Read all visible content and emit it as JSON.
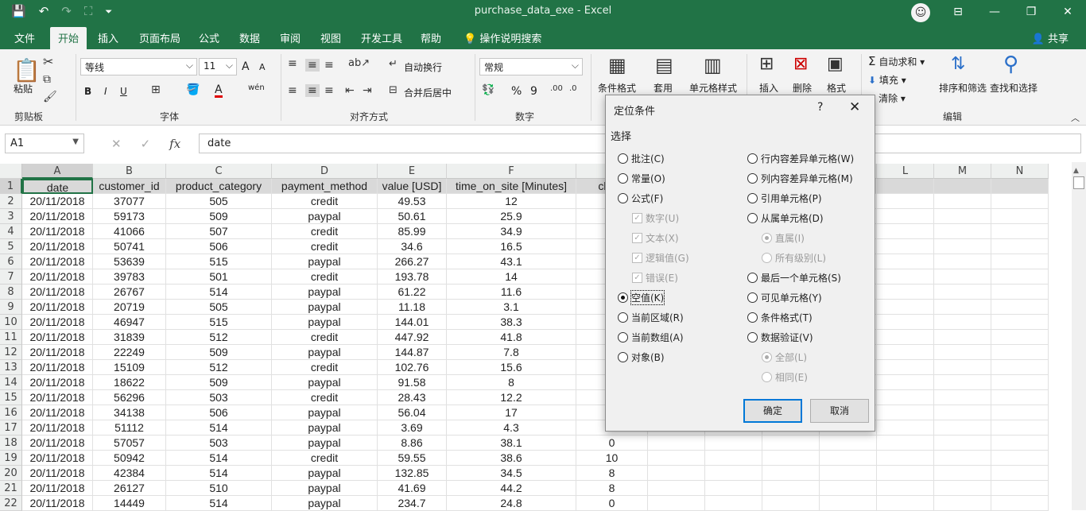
{
  "window": {
    "title": "purchase_data_exe  -  Excel",
    "quick_access": [
      "💾",
      "↶",
      "↷",
      "⛶",
      "⏷"
    ],
    "controls": {
      "ribbon_opts": "⊟",
      "minimize": "—",
      "restore": "❐",
      "close": "✕"
    }
  },
  "menu": {
    "tabs": [
      "文件",
      "开始",
      "插入",
      "页面布局",
      "公式",
      "数据",
      "审阅",
      "视图",
      "开发工具",
      "帮助",
      "操作说明搜索"
    ],
    "active": "开始",
    "share": "共享"
  },
  "ribbon": {
    "clipboard": {
      "paste": "粘贴",
      "label": "剪贴板"
    },
    "font": {
      "name": "等线",
      "size": "11",
      "bold": "B",
      "italic": "I",
      "underline": "U",
      "label": "字体",
      "grow": "A",
      "shrink": "A",
      "phonetic": "wén"
    },
    "alignment": {
      "wrap": "自动换行",
      "merge": "合并后居中",
      "label": "对齐方式"
    },
    "number": {
      "format": "常规",
      "percent": "%",
      "comma": "9",
      "label": "数字"
    },
    "styles": {
      "conditional": "条件格式",
      "table": "套用",
      "cell_styles": "单元格样式"
    },
    "cells": {
      "insert": "插入",
      "delete": "删除",
      "format": "格式"
    },
    "editing": {
      "autosum": "自动求和",
      "fill": "填充",
      "clear": "清除",
      "sort": "排序和筛选",
      "find": "查找和选择",
      "label": "编辑"
    }
  },
  "formula_bar": {
    "name_box": "A1",
    "content": "date",
    "fx": "fx"
  },
  "columns": [
    "A",
    "B",
    "C",
    "D",
    "E",
    "F",
    "G",
    "H",
    "I",
    "J",
    "K",
    "L",
    "M",
    "N"
  ],
  "headers": [
    "date",
    "customer_id",
    "product_category",
    "payment_method",
    "value [USD]",
    "time_on_site [Minutes]",
    "clicks"
  ],
  "rows": [
    [
      "20/11/2018",
      "37077",
      "505",
      "credit",
      "49.53",
      "12",
      ""
    ],
    [
      "20/11/2018",
      "59173",
      "509",
      "paypal",
      "50.61",
      "25.9",
      ""
    ],
    [
      "20/11/2018",
      "41066",
      "507",
      "credit",
      "85.99",
      "34.9",
      ""
    ],
    [
      "20/11/2018",
      "50741",
      "506",
      "credit",
      "34.6",
      "16.5",
      ""
    ],
    [
      "20/11/2018",
      "53639",
      "515",
      "paypal",
      "266.27",
      "43.1",
      ""
    ],
    [
      "20/11/2018",
      "39783",
      "501",
      "credit",
      "193.78",
      "14",
      ""
    ],
    [
      "20/11/2018",
      "26767",
      "514",
      "paypal",
      "61.22",
      "11.6",
      ""
    ],
    [
      "20/11/2018",
      "20719",
      "505",
      "paypal",
      "11.18",
      "3.1",
      ""
    ],
    [
      "20/11/2018",
      "46947",
      "515",
      "paypal",
      "144.01",
      "38.3",
      ""
    ],
    [
      "20/11/2018",
      "31839",
      "512",
      "credit",
      "447.92",
      "41.8",
      ""
    ],
    [
      "20/11/2018",
      "22249",
      "509",
      "paypal",
      "144.87",
      "7.8",
      ""
    ],
    [
      "20/11/2018",
      "15109",
      "512",
      "credit",
      "102.76",
      "15.6",
      ""
    ],
    [
      "20/11/2018",
      "18622",
      "509",
      "paypal",
      "91.58",
      "8",
      ""
    ],
    [
      "20/11/2018",
      "56296",
      "503",
      "credit",
      "28.43",
      "12.2",
      ""
    ],
    [
      "20/11/2018",
      "34138",
      "506",
      "paypal",
      "56.04",
      "17",
      ""
    ],
    [
      "20/11/2018",
      "51112",
      "514",
      "paypal",
      "3.69",
      "4.3",
      ""
    ],
    [
      "20/11/2018",
      "57057",
      "503",
      "paypal",
      "8.86",
      "38.1",
      "0"
    ],
    [
      "20/11/2018",
      "50942",
      "514",
      "credit",
      "59.55",
      "38.6",
      "10"
    ],
    [
      "20/11/2018",
      "42384",
      "514",
      "paypal",
      "132.85",
      "34.5",
      "8"
    ],
    [
      "20/11/2018",
      "26127",
      "510",
      "paypal",
      "41.69",
      "44.2",
      "8"
    ],
    [
      "20/11/2018",
      "14449",
      "514",
      "paypal",
      "234.7",
      "24.8",
      "0"
    ]
  ],
  "dialog": {
    "title": "定位条件",
    "help": "?",
    "close": "✕",
    "section": "选择",
    "left_options": [
      "批注(C)",
      "常量(O)",
      "公式(F)",
      "数字(U)",
      "文本(X)",
      "逻辑值(G)",
      "错误(E)",
      "空值(K)",
      "当前区域(R)",
      "当前数组(A)",
      "对象(B)"
    ],
    "right_options": [
      "行内容差异单元格(W)",
      "列内容差异单元格(M)",
      "引用单元格(P)",
      "从属单元格(D)",
      "直属(I)",
      "所有级别(L)",
      "最后一个单元格(S)",
      "可见单元格(Y)",
      "条件格式(T)",
      "数据验证(V)",
      "全部(L)",
      "相同(E)"
    ],
    "ok": "确定",
    "cancel": "取消"
  }
}
